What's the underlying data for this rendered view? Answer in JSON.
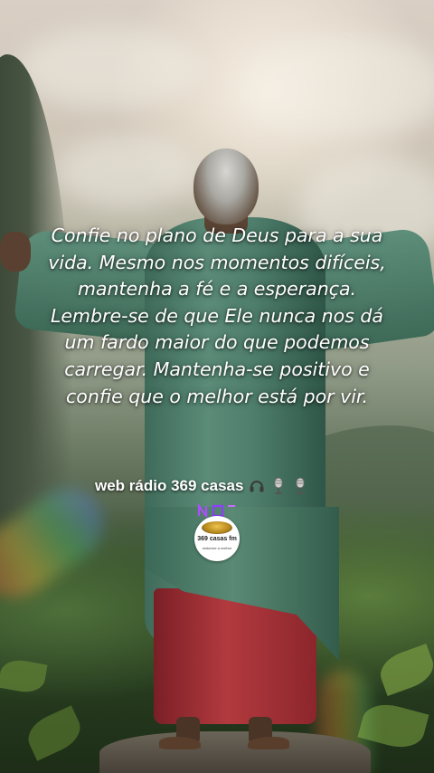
{
  "quote": {
    "text": "Confie no plano de Deus para a sua vida. Mesmo nos momentos difíceis, mantenha a fé e a esperança. Lembre-se de que Ele nunca nos dá um fardo maior do que podemos carregar. Mantenha-se positivo e confie que o melhor está por vir."
  },
  "radio": {
    "name": "web rádio 369 casas",
    "icons": [
      "headphones-icon",
      "microphone-icon",
      "microphone-icon"
    ]
  },
  "logo": {
    "title": "369 casas fm",
    "subtitle": "sintonize a melhor",
    "badge_icon": "neon-badge-icon"
  },
  "colors": {
    "robe": "#4f7e6c",
    "skirt": "#b23a3e",
    "text": "#ffffff"
  }
}
